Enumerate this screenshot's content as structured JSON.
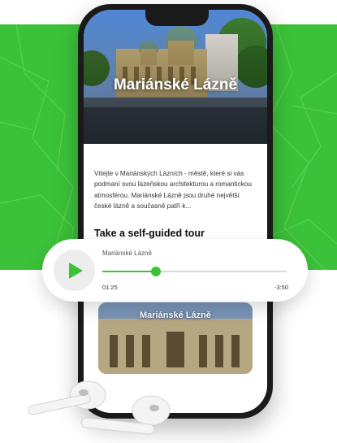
{
  "city_name": "Mariánské Lázně",
  "description": "Vítejte v Mariánských Lázních - městě, které si vás podmaní svou lázeňskou architekturou a romantickou atmosférou. Mariánské Lázně jsou druhé největší české lázně a současně patří k...",
  "tour_section": {
    "title": "Take a self-guided tour"
  },
  "tour_card": {
    "title": "Mariánské Lázně"
  },
  "player": {
    "track": "Mariánské Lázně",
    "elapsed": "01:25",
    "remaining": "-3:50",
    "progress": 0.29,
    "play_icon": "play-icon"
  },
  "colors": {
    "accent": "#3cc23a",
    "phone": "#1a1a1a"
  }
}
